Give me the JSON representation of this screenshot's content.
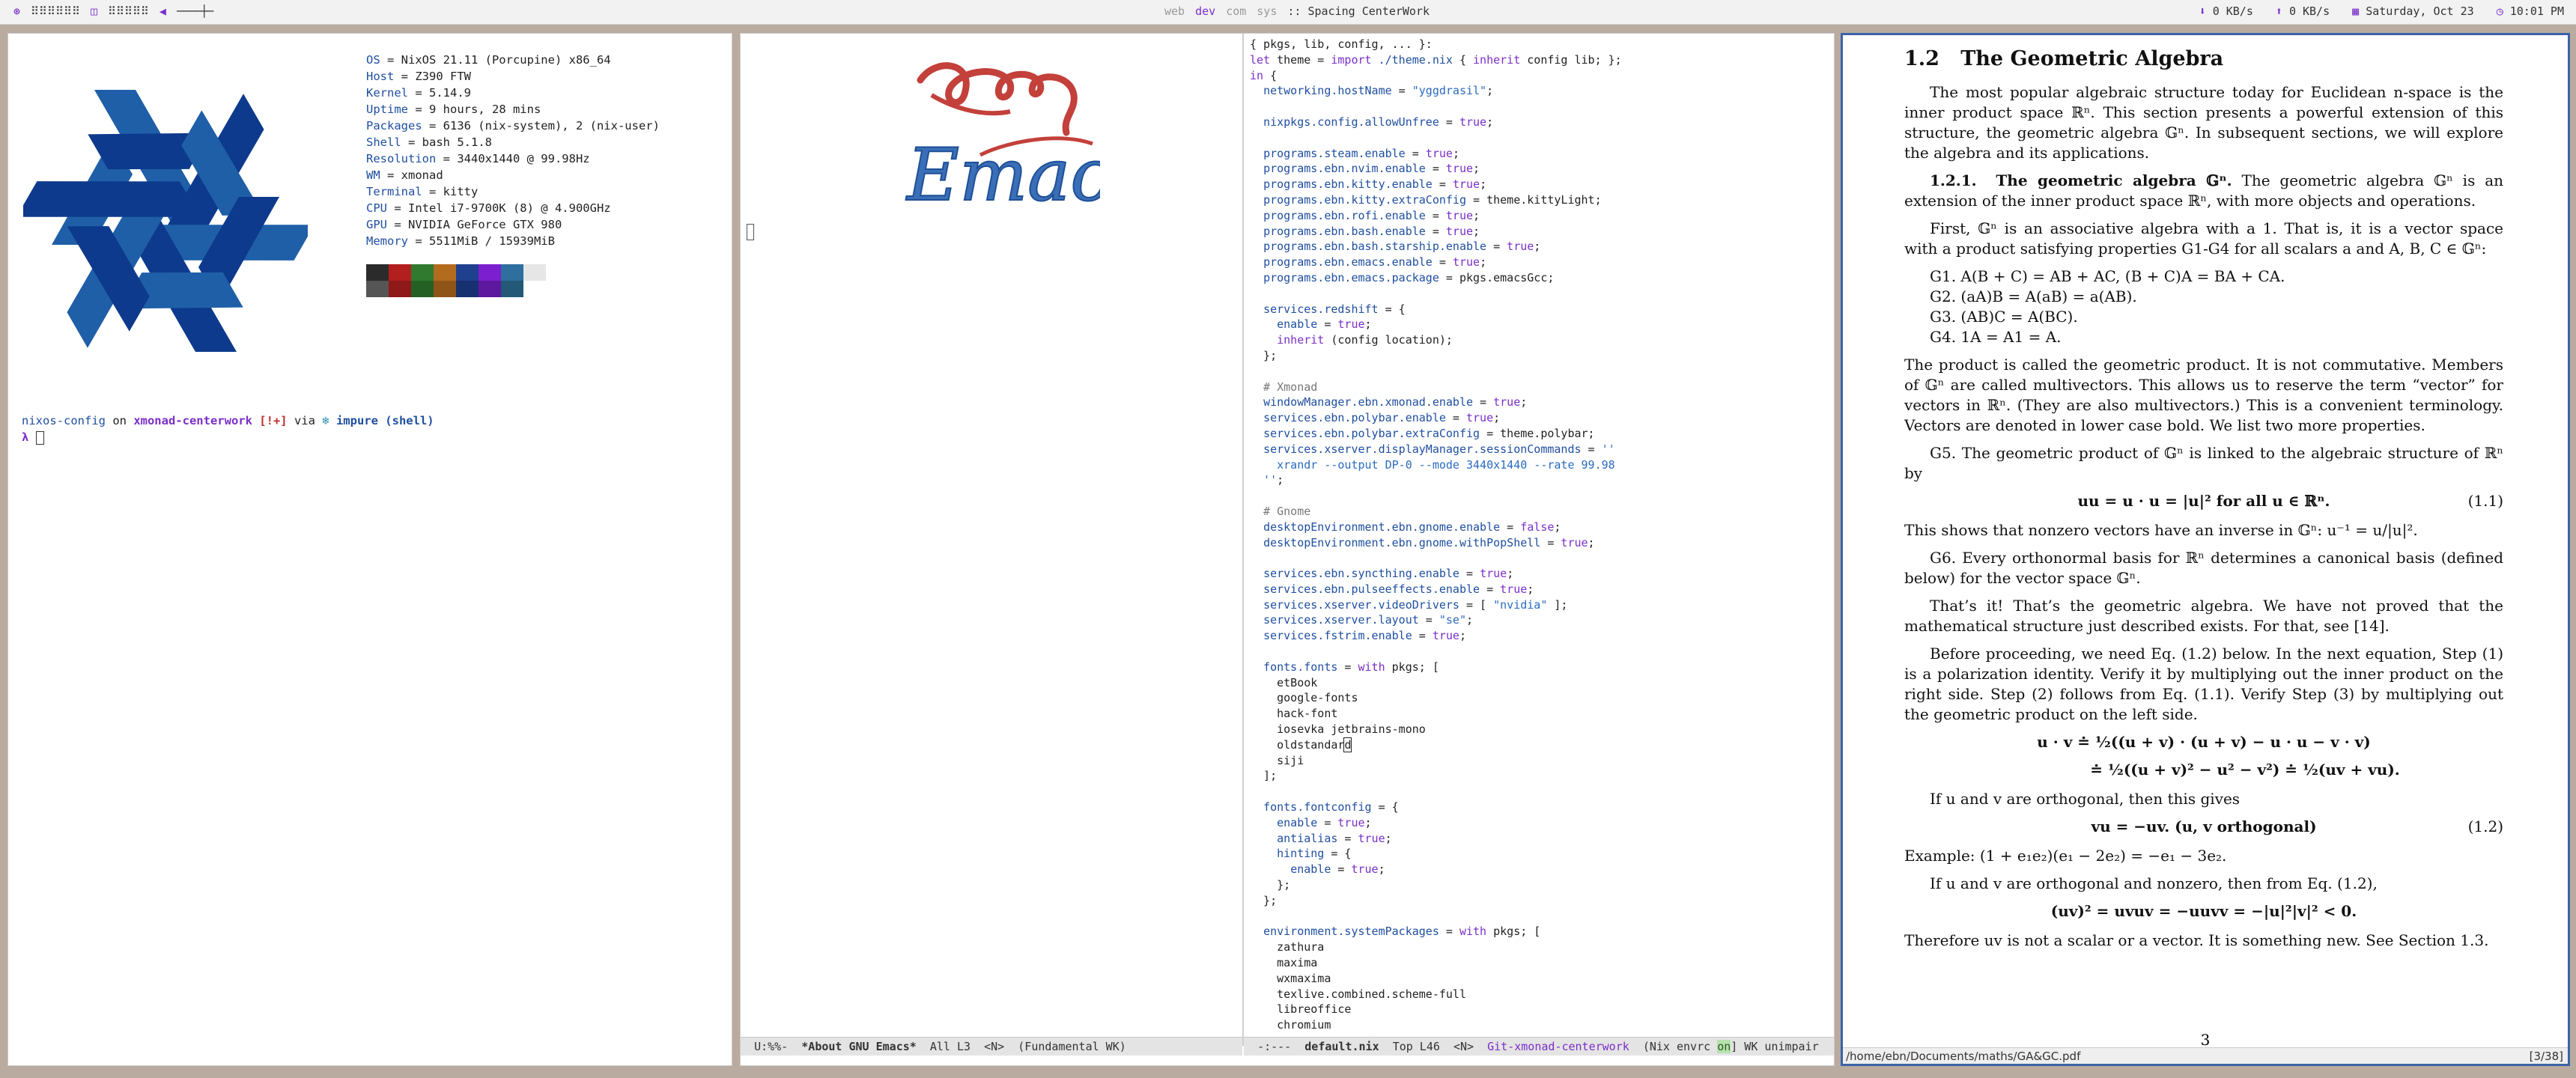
{
  "topbar": {
    "layout_icon": "⊛",
    "left_widget1": "⠿⠿⠿⠿⠿⠿",
    "layout_icon2": "◫",
    "left_widget2": "⠿⠿⠿⠿⠿",
    "volume_icon": "◀",
    "volume_slider": "────┼─",
    "workspaces": [
      "web",
      "dev",
      "com",
      "sys"
    ],
    "active_workspace": "dev",
    "title": ":: Spacing CenterWork",
    "down_rate": "0 KB/s",
    "up_rate": "0 KB/s",
    "date": "Saturday, Oct 23",
    "time": "10:01 PM"
  },
  "terminal": {
    "sysinfo": [
      {
        "key": "OS",
        "value": " = NixOS 21.11 (Porcupine) x86_64"
      },
      {
        "key": "Host",
        "value": " = Z390 FTW"
      },
      {
        "key": "Kernel",
        "value": " = 5.14.9"
      },
      {
        "key": "Uptime",
        "value": " = 9 hours, 28 mins"
      },
      {
        "key": "Packages",
        "value": " = 6136 (nix-system), 2 (nix-user)"
      },
      {
        "key": "Shell",
        "value": " = bash 5.1.8"
      },
      {
        "key": "Resolution",
        "value": " = 3440x1440 @ 99.98Hz"
      },
      {
        "key": "WM",
        "value": " = xmonad"
      },
      {
        "key": "Terminal",
        "value": " = kitty"
      },
      {
        "key": "CPU",
        "value": " = Intel i7-9700K (8) @ 4.900GHz"
      },
      {
        "key": "GPU",
        "value": " = NVIDIA GeForce GTX 980"
      },
      {
        "key": "Memory",
        "value": " = 5511MiB / 15939MiB"
      }
    ],
    "palette_top": [
      "#2b2b2b",
      "#b31e1e",
      "#2f7a2f",
      "#b36b1e",
      "#1f3f8f",
      "#7b1fcf",
      "#2e6f9f",
      "#e6e6e6"
    ],
    "palette_bottom": [
      "#555555",
      "#8f1818",
      "#246024",
      "#8f5518",
      "#17306f",
      "#5e18a0",
      "#235877",
      "#ffffff"
    ],
    "prompt": {
      "dir": "nixos-config",
      "on": " on ",
      "branch_icon": "",
      "branch": " xmonad-centerwork",
      "status": " [!+]",
      "via": " via ",
      "nix_icon": "❄",
      "nix": " impure (shell)",
      "symbol": "λ "
    }
  },
  "emacs": {
    "modeline_left": {
      "state": "U:%%-",
      "buffer": "*About GNU Emacs*",
      "pos": "All L3",
      "evil": "<N>",
      "mode": "(Fundamental WK)"
    },
    "modeline_right": {
      "state": "-:---",
      "buffer": "default.nix",
      "pos": "Top L46",
      "evil": "<N>",
      "vc": "Git-xmonad-centerwork",
      "mode": "(Nix envrc",
      "on": "on",
      "rest": "] WK unimpair"
    },
    "code": [
      [
        [
          "t",
          "{ pkgs, lib, config, ... }:"
        ]
      ],
      [
        [
          "k",
          "let"
        ],
        [
          "t",
          " theme = "
        ],
        [
          "k",
          "import"
        ],
        [
          "t",
          " "
        ],
        [
          "a",
          "./theme.nix"
        ],
        [
          "t",
          " { "
        ],
        [
          "k",
          "inherit"
        ],
        [
          "t",
          " config lib; };"
        ]
      ],
      [
        [
          "k",
          "in"
        ],
        [
          "t",
          " {"
        ]
      ],
      [
        [
          "t",
          "  "
        ],
        [
          "a",
          "networking.hostName"
        ],
        [
          "t",
          " = "
        ],
        [
          "s",
          "\"yggdrasil\""
        ],
        [
          "t",
          ";"
        ]
      ],
      [
        [
          "t",
          ""
        ]
      ],
      [
        [
          "t",
          "  "
        ],
        [
          "a",
          "nixpkgs.config.allowUnfree"
        ],
        [
          "t",
          " = "
        ],
        [
          "k",
          "true"
        ],
        [
          "t",
          ";"
        ]
      ],
      [
        [
          "t",
          ""
        ]
      ],
      [
        [
          "t",
          "  "
        ],
        [
          "a",
          "programs.steam.enable"
        ],
        [
          "t",
          " = "
        ],
        [
          "k",
          "true"
        ],
        [
          "t",
          ";"
        ]
      ],
      [
        [
          "t",
          "  "
        ],
        [
          "a",
          "programs.ebn.nvim.enable"
        ],
        [
          "t",
          " = "
        ],
        [
          "k",
          "true"
        ],
        [
          "t",
          ";"
        ]
      ],
      [
        [
          "t",
          "  "
        ],
        [
          "a",
          "programs.ebn.kitty.enable"
        ],
        [
          "t",
          " = "
        ],
        [
          "k",
          "true"
        ],
        [
          "t",
          ";"
        ]
      ],
      [
        [
          "t",
          "  "
        ],
        [
          "a",
          "programs.ebn.kitty.extraConfig"
        ],
        [
          "t",
          " = theme.kittyLight;"
        ]
      ],
      [
        [
          "t",
          "  "
        ],
        [
          "a",
          "programs.ebn.rofi.enable"
        ],
        [
          "t",
          " = "
        ],
        [
          "k",
          "true"
        ],
        [
          "t",
          ";"
        ]
      ],
      [
        [
          "t",
          "  "
        ],
        [
          "a",
          "programs.ebn.bash.enable"
        ],
        [
          "t",
          " = "
        ],
        [
          "k",
          "true"
        ],
        [
          "t",
          ";"
        ]
      ],
      [
        [
          "t",
          "  "
        ],
        [
          "a",
          "programs.ebn.bash.starship.enable"
        ],
        [
          "t",
          " = "
        ],
        [
          "k",
          "true"
        ],
        [
          "t",
          ";"
        ]
      ],
      [
        [
          "t",
          "  "
        ],
        [
          "a",
          "programs.ebn.emacs.enable"
        ],
        [
          "t",
          " = "
        ],
        [
          "k",
          "true"
        ],
        [
          "t",
          ";"
        ]
      ],
      [
        [
          "t",
          "  "
        ],
        [
          "a",
          "programs.ebn.emacs.package"
        ],
        [
          "t",
          " = pkgs.emacsGcc;"
        ]
      ],
      [
        [
          "t",
          ""
        ]
      ],
      [
        [
          "t",
          "  "
        ],
        [
          "a",
          "services.redshift"
        ],
        [
          "t",
          " = {"
        ]
      ],
      [
        [
          "t",
          "    "
        ],
        [
          "a",
          "enable"
        ],
        [
          "t",
          " = "
        ],
        [
          "k",
          "true"
        ],
        [
          "t",
          ";"
        ]
      ],
      [
        [
          "t",
          "    "
        ],
        [
          "k",
          "inherit"
        ],
        [
          "t",
          " (config location);"
        ]
      ],
      [
        [
          "t",
          "  };"
        ]
      ],
      [
        [
          "t",
          ""
        ]
      ],
      [
        [
          "c",
          "  # Xmonad"
        ]
      ],
      [
        [
          "t",
          "  "
        ],
        [
          "a",
          "windowManager.ebn.xmonad.enable"
        ],
        [
          "t",
          " = "
        ],
        [
          "k",
          "true"
        ],
        [
          "t",
          ";"
        ]
      ],
      [
        [
          "t",
          "  "
        ],
        [
          "a",
          "services.ebn.polybar.enable"
        ],
        [
          "t",
          " = "
        ],
        [
          "k",
          "true"
        ],
        [
          "t",
          ";"
        ]
      ],
      [
        [
          "t",
          "  "
        ],
        [
          "a",
          "services.ebn.polybar.extraConfig"
        ],
        [
          "t",
          " = theme.polybar;"
        ]
      ],
      [
        [
          "t",
          "  "
        ],
        [
          "a",
          "services.xserver.displayManager.sessionCommands"
        ],
        [
          "t",
          " = "
        ],
        [
          "s",
          "''"
        ]
      ],
      [
        [
          "s",
          "    xrandr --output DP-0 --mode 3440x1440 --rate 99.98"
        ]
      ],
      [
        [
          "s",
          "  ''"
        ],
        [
          "t",
          ";"
        ]
      ],
      [
        [
          "t",
          ""
        ]
      ],
      [
        [
          "c",
          "  # Gnome"
        ]
      ],
      [
        [
          "t",
          "  "
        ],
        [
          "a",
          "desktopEnvironment.ebn.gnome.enable"
        ],
        [
          "t",
          " = "
        ],
        [
          "k",
          "false"
        ],
        [
          "t",
          ";"
        ]
      ],
      [
        [
          "t",
          "  "
        ],
        [
          "a",
          "desktopEnvironment.ebn.gnome.withPopShell"
        ],
        [
          "t",
          " = "
        ],
        [
          "k",
          "true"
        ],
        [
          "t",
          ";"
        ]
      ],
      [
        [
          "t",
          ""
        ]
      ],
      [
        [
          "t",
          "  "
        ],
        [
          "a",
          "services.ebn.syncthing.enable"
        ],
        [
          "t",
          " = "
        ],
        [
          "k",
          "true"
        ],
        [
          "t",
          ";"
        ]
      ],
      [
        [
          "t",
          "  "
        ],
        [
          "a",
          "services.ebn.pulseeffects.enable"
        ],
        [
          "t",
          " = "
        ],
        [
          "k",
          "true"
        ],
        [
          "t",
          ";"
        ]
      ],
      [
        [
          "t",
          "  "
        ],
        [
          "a",
          "services.xserver.videoDrivers"
        ],
        [
          "t",
          " = [ "
        ],
        [
          "s",
          "\"nvidia\""
        ],
        [
          "t",
          " ];"
        ]
      ],
      [
        [
          "t",
          "  "
        ],
        [
          "a",
          "services.xserver.layout"
        ],
        [
          "t",
          " = "
        ],
        [
          "s",
          "\"se\""
        ],
        [
          "t",
          ";"
        ]
      ],
      [
        [
          "t",
          "  "
        ],
        [
          "a",
          "services.fstrim.enable"
        ],
        [
          "t",
          " = "
        ],
        [
          "k",
          "true"
        ],
        [
          "t",
          ";"
        ]
      ],
      [
        [
          "t",
          ""
        ]
      ],
      [
        [
          "t",
          "  "
        ],
        [
          "a",
          "fonts.fonts"
        ],
        [
          "t",
          " = "
        ],
        [
          "k",
          "with"
        ],
        [
          "t",
          " pkgs; ["
        ]
      ],
      [
        [
          "t",
          "    etBook"
        ]
      ],
      [
        [
          "t",
          "    google-fonts"
        ]
      ],
      [
        [
          "t",
          "    hack-font"
        ]
      ],
      [
        [
          "t",
          "    iosevka jetbrains-mono"
        ]
      ],
      [
        [
          "t",
          "    oldstandar"
        ],
        [
          "u",
          "d"
        ]
      ],
      [
        [
          "t",
          "    siji"
        ]
      ],
      [
        [
          "t",
          "  ];"
        ]
      ],
      [
        [
          "t",
          ""
        ]
      ],
      [
        [
          "t",
          "  "
        ],
        [
          "a",
          "fonts.fontconfig"
        ],
        [
          "t",
          " = {"
        ]
      ],
      [
        [
          "t",
          "    "
        ],
        [
          "a",
          "enable"
        ],
        [
          "t",
          " = "
        ],
        [
          "k",
          "true"
        ],
        [
          "t",
          ";"
        ]
      ],
      [
        [
          "t",
          "    "
        ],
        [
          "a",
          "antialias"
        ],
        [
          "t",
          " = "
        ],
        [
          "k",
          "true"
        ],
        [
          "t",
          ";"
        ]
      ],
      [
        [
          "t",
          "    "
        ],
        [
          "a",
          "hinting"
        ],
        [
          "t",
          " = {"
        ]
      ],
      [
        [
          "t",
          "      "
        ],
        [
          "a",
          "enable"
        ],
        [
          "t",
          " = "
        ],
        [
          "k",
          "true"
        ],
        [
          "t",
          ";"
        ]
      ],
      [
        [
          "t",
          "    };"
        ]
      ],
      [
        [
          "t",
          "  };"
        ]
      ],
      [
        [
          "t",
          ""
        ]
      ],
      [
        [
          "t",
          "  "
        ],
        [
          "a",
          "environment.systemPackages"
        ],
        [
          "t",
          " = "
        ],
        [
          "k",
          "with"
        ],
        [
          "t",
          " pkgs; ["
        ]
      ],
      [
        [
          "t",
          "    zathura"
        ]
      ],
      [
        [
          "t",
          "    maxima"
        ]
      ],
      [
        [
          "t",
          "    wxmaxima"
        ]
      ],
      [
        [
          "t",
          "    texlive.combined.scheme-full"
        ]
      ],
      [
        [
          "t",
          "    libreoffice"
        ]
      ],
      [
        [
          "t",
          "    chromium"
        ]
      ]
    ]
  },
  "pdf": {
    "section_num": "1.2",
    "section_title": "The Geometric Algebra",
    "p1": "The most popular algebraic structure today for Euclidean n-space is the inner product space ℝⁿ. This section presents a powerful extension of this structure, the geometric algebra 𝔾ⁿ. In subsequent sections, we will explore the algebra and its applications.",
    "sub_num": "1.2.1.",
    "sub_title": "The geometric algebra 𝔾ⁿ.",
    "p2": "The geometric algebra 𝔾ⁿ is an extension of the inner product space ℝⁿ, with more objects and operations.",
    "p3": "First, 𝔾ⁿ is an associative algebra with a 1. That is, it is a vector space with a product satisfying properties G1-G4 for all scalars a and A, B, C ∈ 𝔾ⁿ:",
    "g_items": [
      "G1.  A(B + C) = AB + AC,  (B + C)A = BA + CA.",
      "G2.  (aA)B = A(aB) = a(AB).",
      "G3.  (AB)C = A(BC).",
      "G4.  1A = A1 = A."
    ],
    "p4": "The product is called the geometric product. It is not commutative. Members of 𝔾ⁿ are called multivectors. This allows us to reserve the term “vector” for vectors in ℝⁿ. (They are also multivectors.) This is a convenient terminology. Vectors are denoted in lower case bold. We list two more properties.",
    "p5": "G5. The geometric product of 𝔾ⁿ is linked to the algebraic structure of ℝⁿ by",
    "eq1": "uu = u · u = |u|²   for all u ∈ ℝⁿ.",
    "eq1_num": "(1.1)",
    "p6": "This shows that nonzero vectors have an inverse in 𝔾ⁿ: u⁻¹ = u/|u|².",
    "p7": "G6. Every orthonormal basis for ℝⁿ determines a canonical basis (defined below) for the vector space 𝔾ⁿ.",
    "p8": "That’s it! That’s the geometric algebra. We have not proved that the mathematical structure just described exists. For that, see [14].",
    "p9": "Before proceeding, we need Eq. (1.2) below. In the next equation, Step (1) is a polarization identity. Verify it by multiplying out the inner product on the right side. Step (2) follows from Eq. (1.1). Verify Step (3) by multiplying out the geometric product on the left side.",
    "eq2a": "u · v ≐ ½((u + v) · (u + v) − u · u − v · v)",
    "eq2b": "≐ ½((u + v)² − u² − v²) ≐ ½(uv + vu).",
    "p10": "If u and v are orthogonal, then this gives",
    "eq3": "vu = −uv.   (u, v orthogonal)",
    "eq3_num": "(1.2)",
    "p11": "Example: (1 + e₁e₂)(e₁ − 2e₂) = −e₁ − 3e₂.",
    "p12": "If u and v are orthogonal and nonzero, then from Eq. (1.2),",
    "eq4": "(uv)² = uvuv = −uuvv = −|u|²|v|² < 0.",
    "p13": "Therefore uv is not a scalar or a vector. It is something new. See Section 1.3.",
    "page_number": "3",
    "status_path": "/home/ebn/Documents/maths/GA&GC.pdf",
    "status_page": "[3/38]"
  }
}
